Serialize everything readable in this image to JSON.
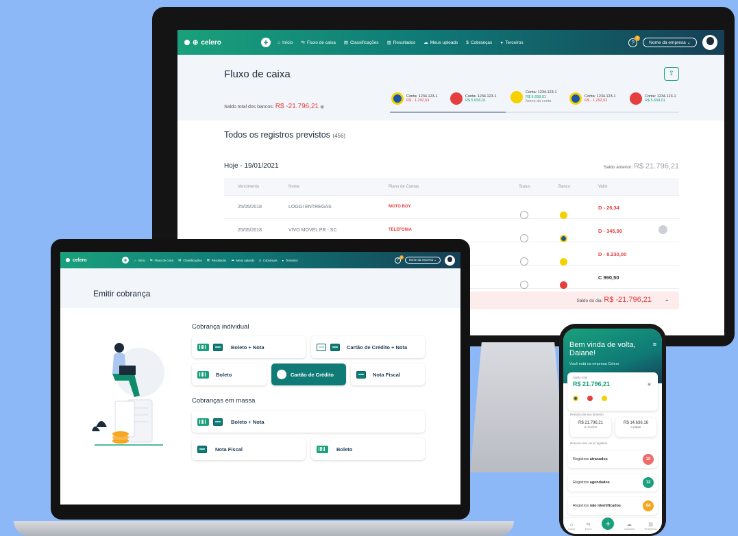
{
  "colors": {
    "background": "#8db8f7",
    "brand_green": "#1aa07c",
    "brand_teal": "#0f7a76",
    "negative": "#e53e3e",
    "orange": "#f5a623"
  },
  "app": {
    "brand": "celero"
  },
  "nav": {
    "items": [
      {
        "label": "Início",
        "icon": "home-icon"
      },
      {
        "label": "Fluxo de caixa",
        "icon": "transfer-icon"
      },
      {
        "label": "Classificações",
        "icon": "document-icon"
      },
      {
        "label": "Resultados",
        "icon": "bar-chart-icon"
      },
      {
        "label": "Meus uploads",
        "icon": "cloud-upload-icon"
      },
      {
        "label": "Cobranças",
        "icon": "money-icon"
      },
      {
        "label": "Terceiros",
        "icon": "people-icon"
      }
    ],
    "help_badge": "2",
    "company_select": "Nome da empresa"
  },
  "desktop": {
    "page_title": "Fluxo de caixa",
    "balance_label": "Saldo total dos bancos:",
    "balance_value": "R$ -21.796,21",
    "accounts": [
      {
        "label": "Conta: 1234.123-1",
        "value": "R$ - 1.292,53",
        "color": "#1a56a8"
      },
      {
        "label": "Conta: 1234.123-1",
        "value": "R$ 5.658,01",
        "color": "#e53e3e"
      },
      {
        "label": "Conta: 1234.123-1",
        "value": "R$ 6.658,01",
        "extra": "Nome da conta",
        "color": "#f5d100"
      },
      {
        "label": "Conta: 1234.123-1",
        "value": "R$ - 1.292,52",
        "color": "#1a56a8"
      },
      {
        "label": "Conta: 1234.123-1",
        "value": "R$ 5.658,01",
        "color": "#e53e3e"
      }
    ],
    "records_title": "Todos os registros previstos",
    "records_count": "(456)",
    "date_title": "Hoje - 19/01/2021",
    "prev_balance_label": "Saldo anterior:",
    "prev_balance_value": "R$ 21.796,21",
    "columns": [
      "Vencimento",
      "Nome",
      "Plano de Contas",
      "Status",
      "Banco",
      "Valor"
    ],
    "rows": [
      {
        "venc": "25/05/2018",
        "nome": "LOGGI ENTREGAS",
        "plano": "MOTO BOY",
        "valor": "D - 26,34",
        "bank": "#f5d100"
      },
      {
        "venc": "25/05/2018",
        "nome": "VIVO MÓVEL PR - SC",
        "plano": "TELEFONIA",
        "valor": "D - 345,90",
        "bank": "#1a56a8"
      },
      {
        "venc": "",
        "nome": "",
        "plano": "",
        "valor": "D - 8.230,00",
        "bank": "#f5d100"
      },
      {
        "venc": "",
        "nome": "",
        "plano": "",
        "valor": "C 990,50",
        "bank": "#e53e3e"
      }
    ],
    "day_balance_label": "Saldo do dia:",
    "day_balance_value": "R$ -21.796,21"
  },
  "laptop": {
    "page_title": "Emitir cobrança",
    "individual_title": "Cobrança individual",
    "individual": [
      "Boleto + Nota",
      "Cartão de Crédito + Nota",
      "Boleto",
      "Cartão de Crédito",
      "Nota Fiscal"
    ],
    "mass_title": "Cobranças em massa",
    "mass": [
      "Boleto + Nota",
      "Nota Fiscal",
      "Boleto"
    ]
  },
  "phone": {
    "greeting": "Bem vinda de volta, Daiane!",
    "subtitle": "Você está na empresa Celero",
    "total_label": "Saldo total",
    "total_value": "R$ 21.796,21",
    "summary_label": "Resumo de seu dinheiro",
    "receive_value": "R$ 21.796,21",
    "receive_label": "a receber",
    "pay_value": "R$ 14.636,16",
    "pay_label": "a pagar",
    "records_label": "Resumo dos seus registros",
    "records": [
      {
        "prefix": "Registros",
        "bold": "atrasados",
        "count": "10",
        "color": "#f06a6a"
      },
      {
        "prefix": "Registros",
        "bold": "agendados",
        "count": "12",
        "color": "#1aa07c"
      },
      {
        "prefix": "Registros",
        "bold": "não identificados",
        "count": "04",
        "color": "#f5a623"
      }
    ],
    "tabs": [
      "Início",
      "Fluxo",
      "Uploads",
      "Relatórios"
    ]
  }
}
